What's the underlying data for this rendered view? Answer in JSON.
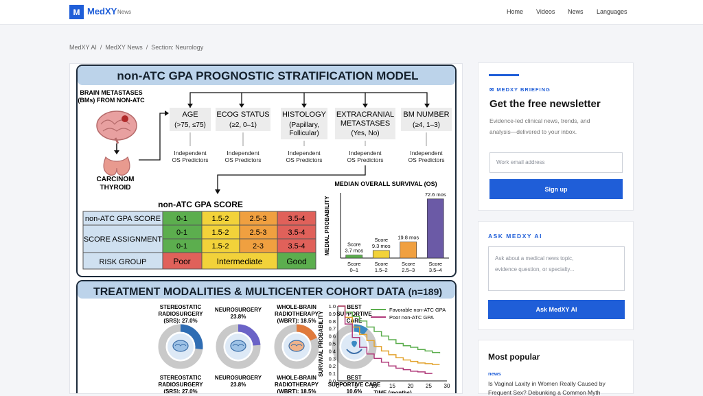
{
  "header": {
    "logo_mark": "M",
    "logo_text": "MedXY",
    "logo_sub": "News",
    "nav": [
      "Home",
      "Videos",
      "News",
      "Languages"
    ]
  },
  "breadcrumb": [
    "MedXY AI",
    "/",
    "MedXY News",
    "/",
    "Section: Neurology"
  ],
  "figure": {
    "title1": "non-ATC GPA PROGNOSTIC STRATIFICATION MODEL",
    "source_label": [
      "BRAIN METASTASES",
      "(BMs) FROM NON-ATC"
    ],
    "thyroid_label": [
      "CARCINOM",
      "THYROID"
    ],
    "predictors": [
      {
        "name": [
          "AGE"
        ],
        "sub": "(>75, ≤75)"
      },
      {
        "name": [
          "ECOG STATUS"
        ],
        "sub": "(≥2, 0–1)"
      },
      {
        "name": [
          "HISTOLOGY"
        ],
        "sub": "(Papillary, Follicular)"
      },
      {
        "name": [
          "EXTRACRANIAL",
          "METASTASES"
        ],
        "sub": "(Yes, No)"
      },
      {
        "name": [
          "BM NUMBER"
        ],
        "sub": "(≥4, 1–3)"
      }
    ],
    "predictor_note": [
      "Independent",
      "OS Predictors"
    ],
    "score_title": "non-ATC GPA SCORE",
    "score_table": {
      "row_labels": [
        "non-ATC GPA SCORE",
        "SCORE ASSIGNMENT",
        "RISK GROUP"
      ],
      "row1": [
        "0-1",
        "1.5-2",
        "2.5-3",
        "3.5-4"
      ],
      "row2": [
        "0-1",
        "1.5-2",
        "2-3",
        "3.5-4"
      ],
      "risk": [
        "Poor",
        "Intermediate",
        "Good"
      ]
    },
    "title2": "TREATMENT MODALITIES & MULTICENTER COHORT DATA",
    "title2_n": "(n=189)",
    "donuts": [
      {
        "top": [
          "STEREOSTATIC",
          "RADIOSURGERY",
          "(SRS): 27.0%"
        ],
        "bottom": [
          "STEREOSTATIC",
          "RADIOSURGERY",
          "(SRS): 27.0%"
        ],
        "pct": 0.27,
        "color": "#2f6db3",
        "icon": "brain-icon"
      },
      {
        "top": [
          "NEUROSURGERY",
          "23.8%"
        ],
        "bottom": [
          "NEUROSURGERY",
          "23.8%"
        ],
        "pct": 0.238,
        "color": "#6b63c7",
        "icon": "head-brain-icon"
      },
      {
        "top": [
          "WHOLE-BRAIN",
          "RADIOTHERAPY",
          "(WBRT): 18.5%"
        ],
        "bottom": [
          "WHOLE-BRAIN",
          "RADIOTHERAPY",
          "(WBRT): 18.5%"
        ],
        "pct": 0.185,
        "color": "#e07a3c",
        "icon": "head-brain-icon"
      },
      {
        "top": [
          "BEST",
          "SUPPORTIVE",
          "CARE"
        ],
        "bottom": [
          "BEST",
          "SUPPORTIVE CARE",
          "10.6%"
        ],
        "pct": 0.106,
        "color": "#3b8ac4",
        "icon": "hand-heart-icon"
      }
    ]
  },
  "chart_data": [
    {
      "type": "bar",
      "title": "MEDIAN OVERALL SURVIVAL (OS)",
      "ylabel": "MEDIAL PROBABILITY",
      "categories": [
        "Score 0–1",
        "Score 1.5–2",
        "Score 2.5–3",
        "Score 3.5–4"
      ],
      "values": [
        3.7,
        9.3,
        19.8,
        72.6
      ],
      "data_labels": [
        "Score 3.7 mos",
        "Score 9.3 mos",
        "19.8 mos",
        "72.6 mos"
      ],
      "colors": [
        "#5cae4e",
        "#f2d23a",
        "#f0a040",
        "#6b5aa6"
      ],
      "ylim": [
        0,
        80
      ]
    },
    {
      "type": "line",
      "ylabel": "SURVIVAL PROBABILITY",
      "xlabel": "TIME (months)",
      "xlim": [
        0,
        30
      ],
      "ylim": [
        0,
        1.0
      ],
      "xticks": [
        0,
        5,
        10,
        15,
        20,
        25,
        30
      ],
      "yticks": [
        0.0,
        0.1,
        0.2,
        0.3,
        0.4,
        0.5,
        0.6,
        0.7,
        0.8,
        0.9,
        1.0
      ],
      "legend": "top-right",
      "series": [
        {
          "name": "Favorable non-ATC GPA",
          "color": "#5cae4e",
          "x": [
            0,
            2,
            4,
            6,
            8,
            10,
            12,
            14,
            16,
            18,
            20,
            22,
            24,
            26,
            28
          ],
          "y": [
            1.0,
            0.92,
            0.86,
            0.8,
            0.72,
            0.66,
            0.6,
            0.55,
            0.5,
            0.47,
            0.45,
            0.42,
            0.4,
            0.38,
            0.37
          ]
        },
        {
          "name": "",
          "color": "#e3a32e",
          "x": [
            0,
            2,
            4,
            6,
            8,
            10,
            12,
            14,
            16,
            18,
            20,
            22,
            24,
            26,
            28
          ],
          "y": [
            1.0,
            0.85,
            0.72,
            0.62,
            0.54,
            0.46,
            0.4,
            0.35,
            0.31,
            0.28,
            0.26,
            0.24,
            0.23,
            0.22,
            0.22
          ]
        },
        {
          "name": "Poor non-ATC GPA",
          "color": "#b03a7a",
          "x": [
            0,
            2,
            4,
            6,
            8,
            10,
            12,
            14,
            16,
            18,
            20,
            22,
            24,
            26
          ],
          "y": [
            1.0,
            0.76,
            0.58,
            0.45,
            0.36,
            0.3,
            0.25,
            0.2,
            0.17,
            0.15,
            0.13,
            0.12,
            0.1,
            0.1
          ]
        }
      ]
    }
  ],
  "sidebar": {
    "newsletter": {
      "kicker": "MEDXY BRIEFING",
      "title": "Get the free newsletter",
      "desc": [
        "Evidence-led clinical news, trends, and",
        "analysis—delivered to your inbox."
      ],
      "placeholder": "Work email address",
      "button": "Sign up"
    },
    "ask": {
      "kicker": "ASK MEDXY AI",
      "placeholder": [
        "Ask about a medical news topic,",
        "evidence question, or specialty..."
      ],
      "button": "Ask MedXY AI"
    },
    "popular": {
      "title": "Most popular",
      "tag": "news",
      "headline": [
        "Is Vaginal Laxity in Women Really Caused by",
        "Frequent Sex? Debunking a Common Myth"
      ]
    }
  },
  "colors": {
    "brand": "#1f5ed8",
    "panel_header": "#bcd3ea",
    "green": "#5cae4e",
    "yellow": "#f2d23a",
    "orange": "#f0a040",
    "red": "#e0615a",
    "purple": "#6b5aa6"
  }
}
